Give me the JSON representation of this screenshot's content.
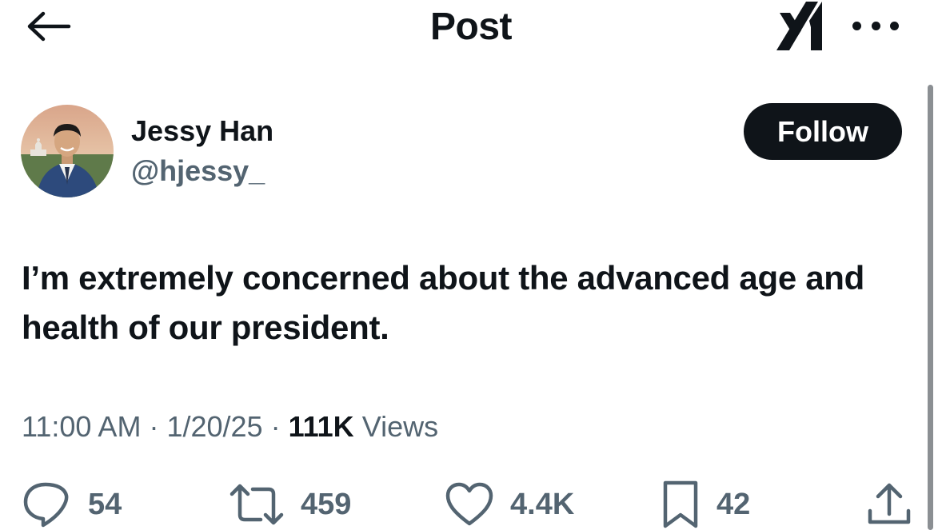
{
  "header": {
    "title": "Post",
    "back_icon": "arrow-left-icon",
    "grok_icon": "grok-icon",
    "more_icon": "more-horizontal-icon"
  },
  "author": {
    "name": "Jessy Han",
    "handle": "@hjessy_",
    "follow_label": "Follow"
  },
  "post": {
    "text": "I’m extremely concerned about the advanced age and health of our president."
  },
  "meta": {
    "time": "11:00 AM",
    "date": "1/20/25",
    "views_count": "111K",
    "views_label": "Views"
  },
  "actions": {
    "replies": "54",
    "reposts": "459",
    "likes": "4.4K",
    "bookmarks": "42"
  },
  "colors": {
    "text": "#0f1419",
    "secondary": "#536471",
    "button": "#0f1419"
  }
}
